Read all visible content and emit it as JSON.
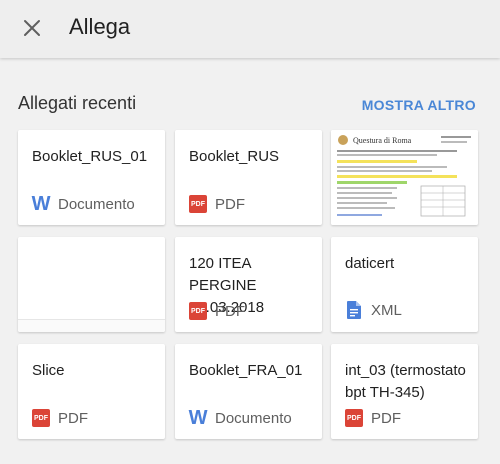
{
  "header": {
    "title": "Allega",
    "close_icon": "close-icon"
  },
  "section": {
    "title": "Allegati recenti",
    "more_label": "MOSTRA ALTRO"
  },
  "colors": {
    "link": "#4a87d6",
    "pdf": "#db4437",
    "word": "#4a7fd9",
    "xml": "#4a7fd9"
  },
  "preview": {
    "heading": "Questura di Roma"
  },
  "cards": [
    {
      "name": "Booklet_RUS_01",
      "type": "Documento",
      "icon": "word-icon"
    },
    {
      "name": "Booklet_RUS",
      "type": "PDF",
      "icon": "pdf-icon"
    },
    {
      "name": "",
      "type": "",
      "icon": "document-preview-thumbnail"
    },
    {
      "name": "",
      "type": "",
      "icon": "blank-thumbnail"
    },
    {
      "name": "120 ITEA PERGINE 13.03.2018",
      "type": "PDF",
      "icon": "pdf-icon"
    },
    {
      "name": "daticert",
      "type": "XML",
      "icon": "doc-icon"
    },
    {
      "name": "Slice",
      "type": "PDF",
      "icon": "pdf-icon"
    },
    {
      "name": "Booklet_FRA_01",
      "type": "Documento",
      "icon": "word-icon"
    },
    {
      "name": "int_03 (termostato bpt TH-345)",
      "type": "PDF",
      "icon": "pdf-icon"
    }
  ]
}
